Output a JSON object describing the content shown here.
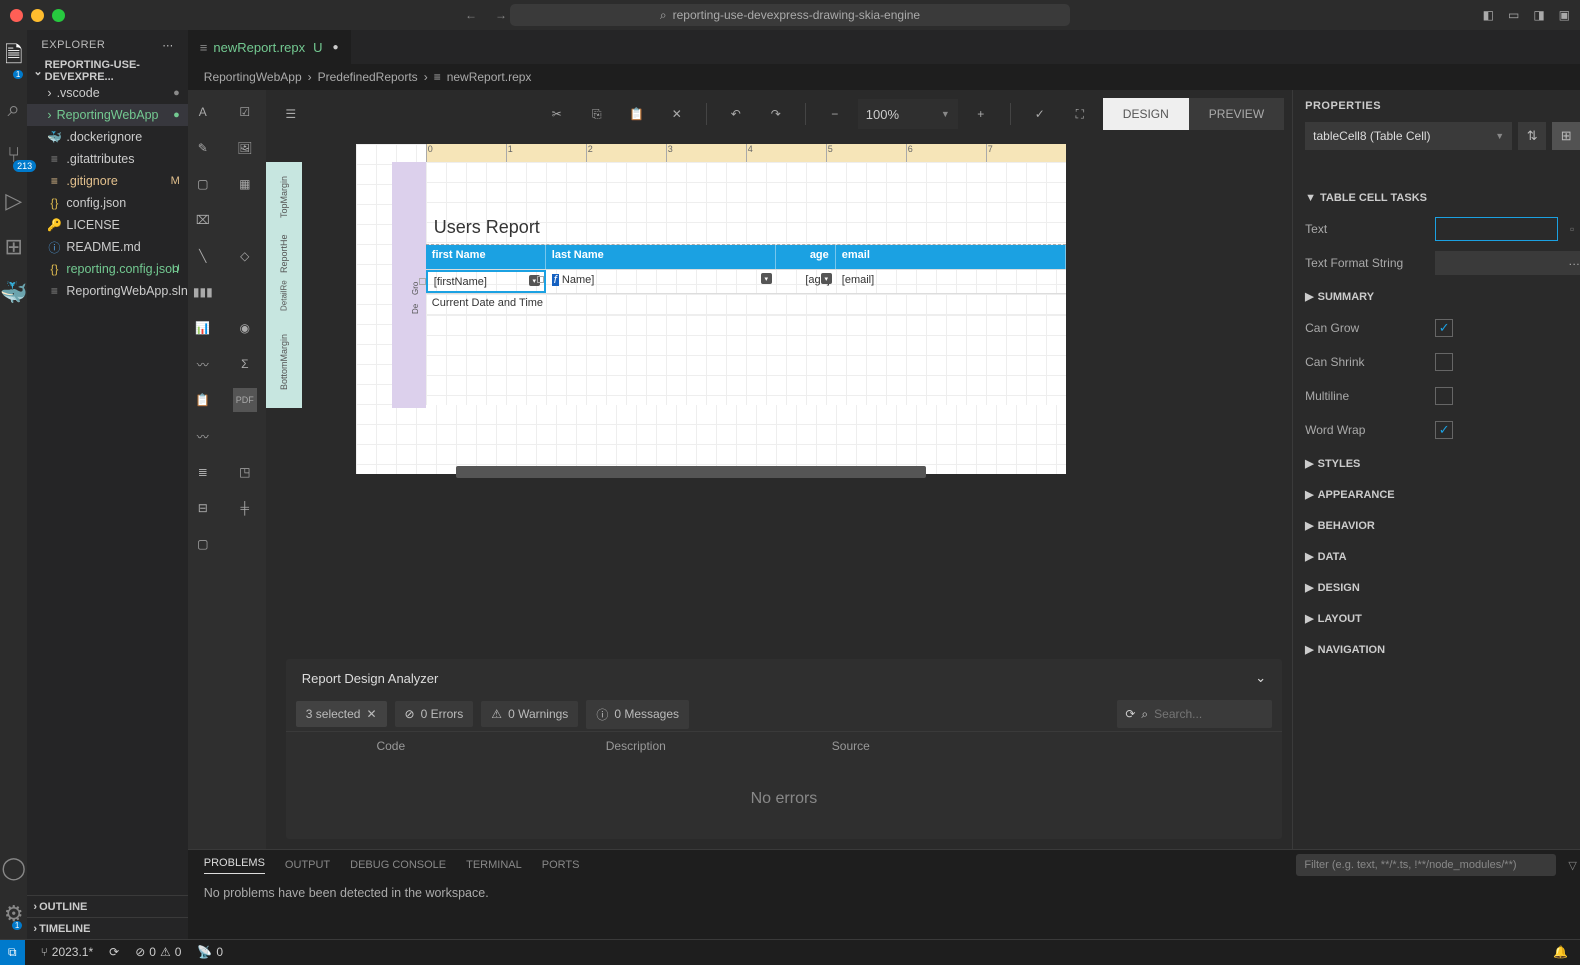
{
  "title_bar": {
    "search_text": "reporting-use-devexpress-drawing-skia-engine"
  },
  "sidebar": {
    "header": "EXPLORER",
    "root": "REPORTING-USE-DEVEXPRE...",
    "tree": [
      {
        "name": ".vscode",
        "type": "folder",
        "status_dot": true
      },
      {
        "name": "ReportingWebApp",
        "type": "folder",
        "selected": true,
        "status_dot": true,
        "green": true
      },
      {
        "name": ".dockerignore",
        "type": "file"
      },
      {
        "name": ".gitattributes",
        "type": "file"
      },
      {
        "name": ".gitignore",
        "type": "file",
        "status": "M",
        "orange": true
      },
      {
        "name": "config.json",
        "type": "file",
        "icon": "{}"
      },
      {
        "name": "LICENSE",
        "type": "file",
        "icon": "🔑"
      },
      {
        "name": "README.md",
        "type": "file",
        "icon": "ⓘ"
      },
      {
        "name": "reporting.config.json",
        "type": "file",
        "icon": "{}",
        "status": "U",
        "green": true
      },
      {
        "name": "ReportingWebApp.sln",
        "type": "file",
        "icon": "≡"
      }
    ],
    "outline": "OUTLINE",
    "timeline": "TIMELINE"
  },
  "activity": {
    "scm_badge": "213",
    "settings_badge": "1",
    "explorer_badge": "1"
  },
  "editor": {
    "tab": {
      "name": "newReport.repx",
      "status": "U"
    },
    "breadcrumbs": [
      "ReportingWebApp",
      "PredefinedReports",
      "newReport.repx"
    ],
    "toolbar": {
      "zoom": "100%",
      "design": "DESIGN",
      "preview": "PREVIEW"
    },
    "report": {
      "title": "Users Report",
      "headers": [
        "first Name",
        "last Name",
        "age",
        "email"
      ],
      "detail": [
        "[firstName]",
        "Name]",
        "[age]",
        "[email]"
      ],
      "footer": "Current Date and Time",
      "bands": {
        "top": "TopMargin",
        "rh": "ReportHe",
        "dr": "DetailRe",
        "de": "De",
        "gr": "Gro",
        "bm": "BottomMargin"
      }
    },
    "analyzer": {
      "title": "Report Design Analyzer",
      "selected": "3 selected",
      "errors": "0 Errors",
      "warnings": "0 Warnings",
      "messages": "0 Messages",
      "search_placeholder": "Search...",
      "cols": [
        "Code",
        "Description",
        "Source"
      ],
      "empty": "No errors"
    }
  },
  "properties": {
    "title": "PROPERTIES",
    "selection": "tableCell8 (Table Cell)",
    "sections": {
      "tasks": "TABLE CELL TASKS",
      "summary": "SUMMARY",
      "styles": "STYLES",
      "appearance": "APPEARANCE",
      "behavior": "BEHAVIOR",
      "data": "DATA",
      "design": "DESIGN",
      "layout": "LAYOUT",
      "navigation": "NAVIGATION"
    },
    "fields": {
      "text": {
        "label": "Text",
        "value": ""
      },
      "format": {
        "label": "Text Format String",
        "value": ""
      },
      "cangrow": {
        "label": "Can Grow",
        "checked": true
      },
      "canshrink": {
        "label": "Can Shrink",
        "checked": false
      },
      "multiline": {
        "label": "Multiline",
        "checked": false
      },
      "wordwrap": {
        "label": "Word Wrap",
        "checked": true
      }
    }
  },
  "bottom_panel": {
    "tabs": [
      "PROBLEMS",
      "OUTPUT",
      "DEBUG CONSOLE",
      "TERMINAL",
      "PORTS"
    ],
    "filter_placeholder": "Filter (e.g. text, **/*.ts, !**/node_modules/**)",
    "message": "No problems have been detected in the workspace."
  },
  "status_bar": {
    "branch": "2023.1*",
    "sync": "⟳",
    "errors": "0",
    "warnings": "0",
    "ports": "0"
  },
  "ruler_ticks": [
    "0",
    "1",
    "2",
    "3",
    "4",
    "5",
    "6",
    "7"
  ]
}
